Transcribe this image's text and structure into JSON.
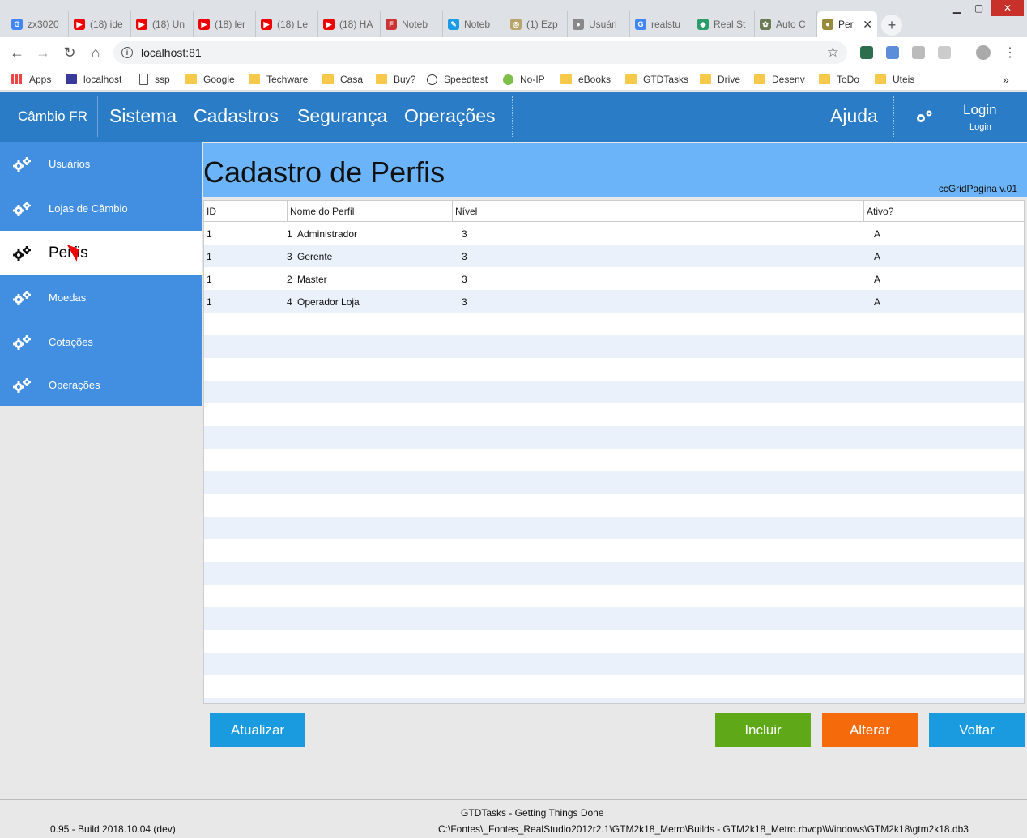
{
  "browser": {
    "tabs": [
      {
        "label": "zx3020",
        "fav_color": "#4285f4",
        "fav_glyph": "G"
      },
      {
        "label": "(18) ide",
        "fav_color": "#e00",
        "fav_glyph": "▶"
      },
      {
        "label": "(18) Un",
        "fav_color": "#e00",
        "fav_glyph": "▶"
      },
      {
        "label": "(18) ler",
        "fav_color": "#e00",
        "fav_glyph": "▶"
      },
      {
        "label": "(18) Le",
        "fav_color": "#e00",
        "fav_glyph": "▶"
      },
      {
        "label": "(18) HA",
        "fav_color": "#e00",
        "fav_glyph": "▶"
      },
      {
        "label": "Noteb",
        "fav_color": "#c33",
        "fav_glyph": "F"
      },
      {
        "label": "Noteb",
        "fav_color": "#1a9be6",
        "fav_glyph": "✎"
      },
      {
        "label": "(1) Ezp",
        "fav_color": "#b9a56a",
        "fav_glyph": "◎"
      },
      {
        "label": "Usuári",
        "fav_color": "#888",
        "fav_glyph": "●"
      },
      {
        "label": "realstu",
        "fav_color": "#4285f4",
        "fav_glyph": "G"
      },
      {
        "label": "Real St",
        "fav_color": "#2a9d6a",
        "fav_glyph": "◆"
      },
      {
        "label": "Auto C",
        "fav_color": "#6a7a52",
        "fav_glyph": "✿"
      },
      {
        "label": "Per",
        "fav_color": "#9a8b3a",
        "fav_glyph": "●",
        "active": true
      }
    ],
    "close_tab_glyph": "✕",
    "new_tab_glyph": "+",
    "window_controls": {
      "minimize": "▁",
      "maximize": "▢",
      "close": "✕"
    },
    "url": "localhost:81",
    "bookmarks": [
      {
        "label": "Apps",
        "icon": "apps-icon"
      },
      {
        "label": "localhost",
        "icon": "u-icon"
      },
      {
        "label": "ssp",
        "icon": "page-icon"
      },
      {
        "label": "Google",
        "icon": "folder-icon"
      },
      {
        "label": "Techware",
        "icon": "folder-icon"
      },
      {
        "label": "Casa",
        "icon": "folder-icon"
      },
      {
        "label": "Buy?",
        "icon": "folder-icon"
      },
      {
        "label": "Speedtest",
        "icon": "gauge-icon"
      },
      {
        "label": "No-IP",
        "icon": "noip-icon"
      },
      {
        "label": "eBooks",
        "icon": "folder-icon"
      },
      {
        "label": "GTDTasks",
        "icon": "folder-icon"
      },
      {
        "label": "Drive",
        "icon": "folder-icon"
      },
      {
        "label": "Desenv",
        "icon": "folder-icon"
      },
      {
        "label": "ToDo",
        "icon": "folder-icon"
      },
      {
        "label": "Uteis",
        "icon": "folder-icon"
      }
    ],
    "bookmarks_overflow": "»"
  },
  "app": {
    "brand": "Câmbio FR",
    "menu": [
      "Sistema",
      "Cadastros",
      "Segurança",
      "Operações"
    ],
    "help": "Ajuda",
    "login": "Login",
    "login_sub": "Login"
  },
  "sidebar": {
    "items": [
      {
        "label": "Usuários"
      },
      {
        "label": "Lojas de Câmbio"
      },
      {
        "label": "Perfis",
        "active": true
      },
      {
        "label": "Moedas"
      },
      {
        "label": "Cotações"
      },
      {
        "label": "Operações"
      }
    ]
  },
  "page": {
    "title": "Cadastro de Perfis",
    "version": "ccGridPagina v.01"
  },
  "grid": {
    "columns": [
      "ID",
      "Nome do Perfil",
      "Nível",
      "Ativo?"
    ],
    "rows": [
      {
        "id": "1",
        "num": "1",
        "name": "Administrador",
        "nivel": "3",
        "ativo": "A"
      },
      {
        "id": "1",
        "num": "3",
        "name": "Gerente",
        "nivel": "3",
        "ativo": "A"
      },
      {
        "id": "1",
        "num": "2",
        "name": "Master",
        "nivel": "3",
        "ativo": "A"
      },
      {
        "id": "1",
        "num": "4",
        "name": "Operador Loja",
        "nivel": "3",
        "ativo": "A"
      }
    ]
  },
  "buttons": {
    "refresh": "Atualizar",
    "add": "Incluir",
    "edit": "Alterar",
    "back": "Voltar"
  },
  "colors": {
    "refresh": "#1a9be0",
    "add": "#5fa818",
    "edit": "#f56a0a",
    "back": "#1a9be0"
  },
  "footer": {
    "app_name": "GTDTasks - Getting Things Done",
    "build": "0.95 - Build 2018.10.04 (dev)",
    "path": "C:\\Fontes\\_Fontes_RealStudio2012r2.1\\GTM2k18_Metro\\Builds - GTM2k18_Metro.rbvcp\\Windows\\GTM2k18\\gtm2k18.db3"
  }
}
